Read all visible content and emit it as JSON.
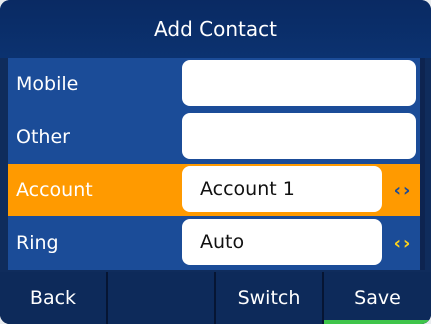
{
  "title": "Add Contact",
  "rows": [
    {
      "label": "Mobile",
      "value": ""
    },
    {
      "label": "Other",
      "value": ""
    },
    {
      "label": "Account",
      "value": "Account 1"
    },
    {
      "label": "Ring",
      "value": "Auto"
    }
  ],
  "selected_row": "Account",
  "softkeys": {
    "back": "Back",
    "empty": "",
    "switch": "Switch",
    "save": "Save"
  },
  "colors": {
    "background": "#1b4c98",
    "title_bar": "#0b3270",
    "selected_row": "#ff9a00",
    "arrow": "#ffd21a",
    "softkey_highlight": "#3fc54a"
  },
  "icons": {
    "left_right_arrow": "chevron-left-right-icon"
  }
}
